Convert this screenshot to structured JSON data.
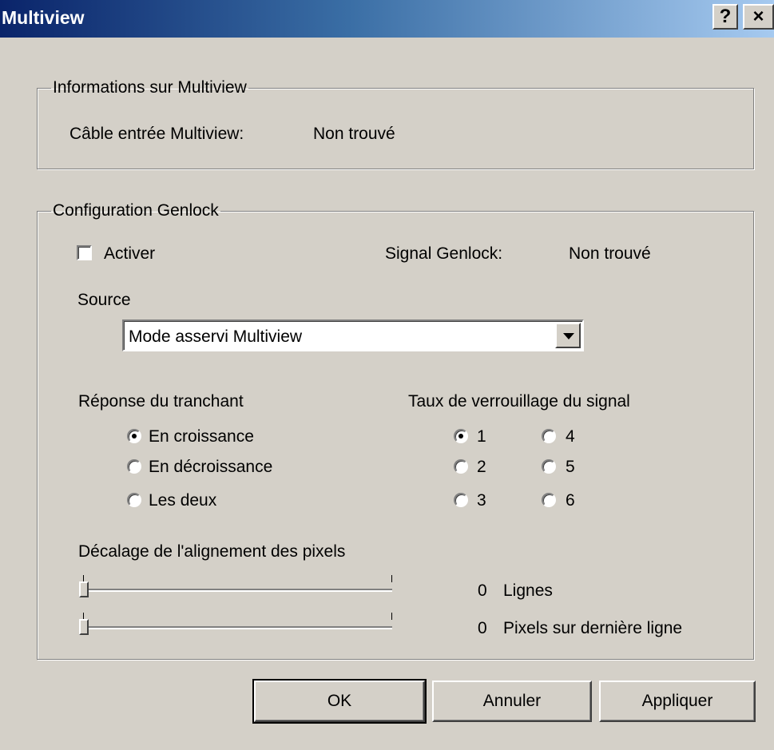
{
  "window": {
    "title": "Multiview",
    "help_label": "?",
    "close_label": "×"
  },
  "info_group": {
    "legend": "Informations sur Multiview",
    "cable_label": "Câble entrée Multiview:",
    "cable_value": "Non trouvé"
  },
  "genlock_group": {
    "legend": "Configuration Genlock",
    "enable_label": "Activer",
    "enable_checked": false,
    "signal_label": "Signal Genlock:",
    "signal_value": "Non trouvé",
    "source_label": "Source",
    "source_selected": "Mode asservi Multiview",
    "edge_label": "Réponse du tranchant",
    "edge_options": [
      "En croissance",
      "En décroissance",
      "Les deux"
    ],
    "edge_selected": "En croissance",
    "lock_rate_label": "Taux de verrouillage du signal",
    "lock_rate_options": [
      "1",
      "2",
      "3",
      "4",
      "5",
      "6"
    ],
    "lock_rate_selected": "1",
    "pixel_offset_label": "Décalage de l'alignement des pixels",
    "lines_value": "0",
    "lines_unit": "Lignes",
    "pixels_value": "0",
    "pixels_unit": "Pixels sur dernière ligne"
  },
  "buttons": {
    "ok": "OK",
    "cancel": "Annuler",
    "apply": "Appliquer"
  },
  "colors": {
    "titlebar_start": "#0a246a",
    "titlebar_end": "#a6caf0",
    "dialog_bg": "#d4d0c8"
  }
}
